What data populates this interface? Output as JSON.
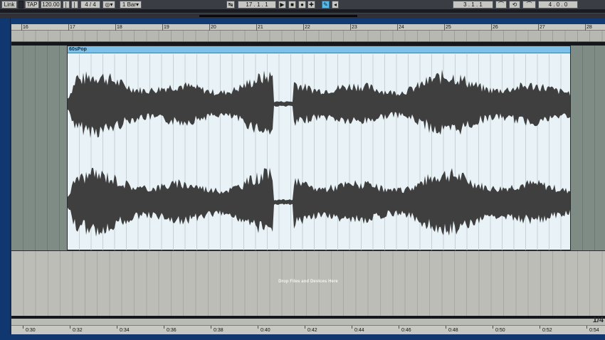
{
  "transport": {
    "link_label": "Link",
    "tap_label": "TAP",
    "tempo": "120.00",
    "time_signature": "4 / 4",
    "quantize_label": "1 Bar",
    "position": "17 .   1 .   1",
    "loop_start": "3 .   1 .   1",
    "loop_length": "4 .   0 .   0",
    "accent_color": "#5ab9e8"
  },
  "beat_ruler": {
    "labels": [
      "16",
      "17",
      "18",
      "19",
      "20",
      "21",
      "22",
      "23",
      "24",
      "25",
      "26",
      "27",
      "28"
    ]
  },
  "clip": {
    "name": "60sPop",
    "header_color": "#7ec2ea",
    "waveform_color": "#3f3f3f"
  },
  "drop_area": {
    "text": "Drop Files and Devices Here"
  },
  "page_indicator": "1/4",
  "time_ruler": {
    "labels": [
      "0:30",
      "0:32",
      "0:34",
      "0:36",
      "0:38",
      "0:40",
      "0:42",
      "0:44",
      "0:46",
      "0:48",
      "0:50",
      "0:52",
      "0:54"
    ]
  }
}
